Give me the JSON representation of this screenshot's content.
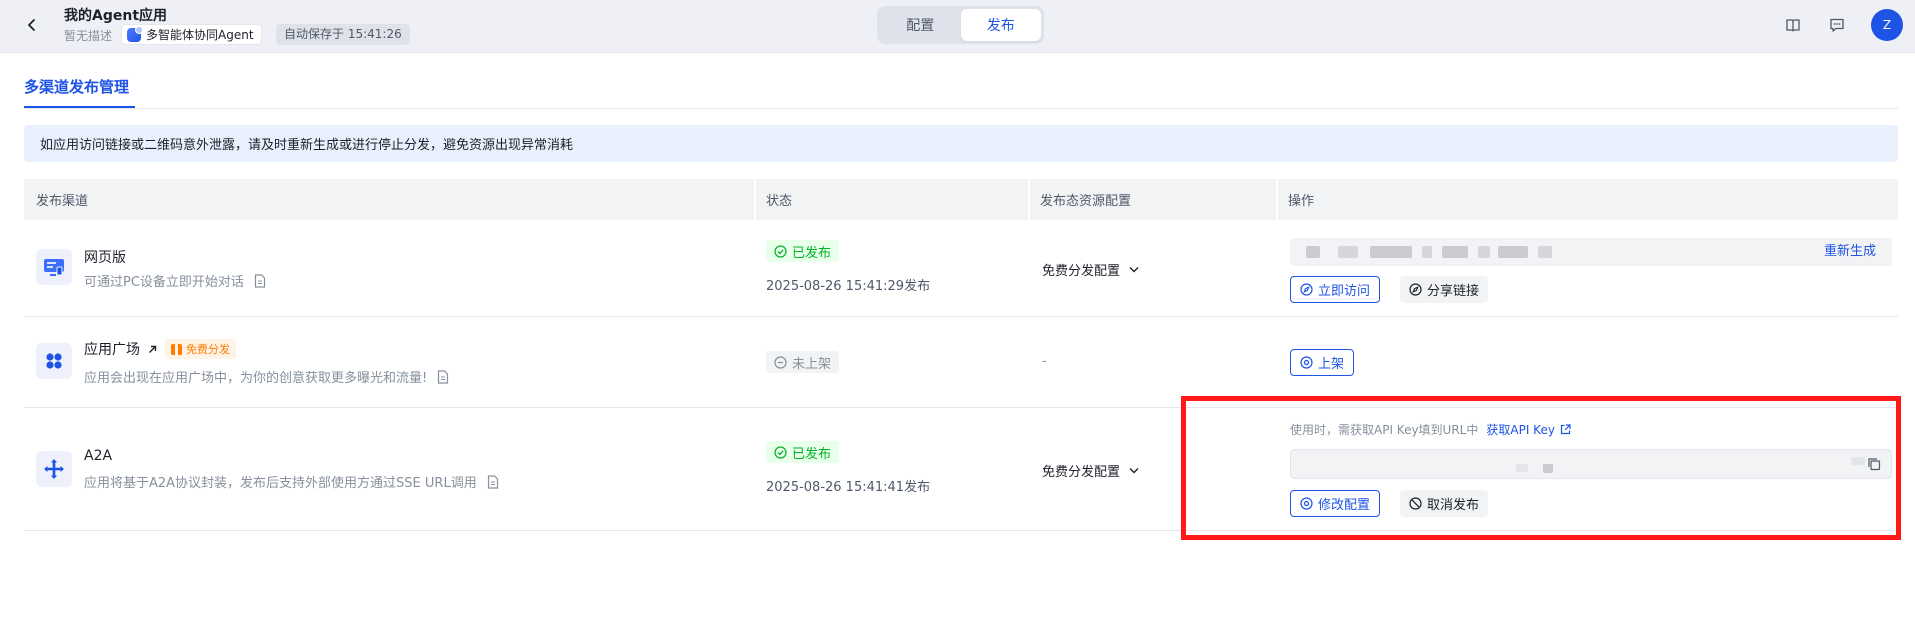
{
  "header": {
    "app_title": "我的Agent应用",
    "app_desc": "暂无描述",
    "mode_tag": "多智能体协同Agent",
    "autosave": "自动保存于 15:41:26",
    "tabs": [
      {
        "label": "配置",
        "active": false
      },
      {
        "label": "发布",
        "active": true
      }
    ],
    "avatar_initial": "Z",
    "icons": [
      "chevron-left-icon",
      "book-icon",
      "feedback-icon"
    ]
  },
  "section": {
    "title": "多渠道发布管理",
    "notice": "如应用访问链接或二维码意外泄露，请及时重新生成或进行停止分发，避免资源出现异常消耗"
  },
  "table": {
    "columns": [
      "发布渠道",
      "状态",
      "发布态资源配置",
      "操作"
    ],
    "rows": [
      {
        "name": "网页版",
        "desc": "可通过PC设备立即开始对话",
        "status": "已发布",
        "status_kind": "published",
        "time": "2025-08-26 15:41:29发布",
        "resource": "免费分发配置",
        "action_link": "重新生成",
        "buttons": [
          "立即访问",
          "分享链接"
        ]
      },
      {
        "name": "应用广场",
        "badge": "免费分发",
        "desc": "应用会出现在应用广场中，为你的创意获取更多曝光和流量!",
        "status": "未上架",
        "status_kind": "unlisted",
        "resource": "-",
        "buttons": [
          "上架"
        ]
      },
      {
        "name": "A2A",
        "desc": "应用将基于A2A协议封装，发布后支持外部使用方通过SSE URL调用",
        "status": "已发布",
        "status_kind": "published",
        "time": "2025-08-26 15:41:41发布",
        "resource": "免费分发配置",
        "api_tip": "使用时，需获取API Key填到URL中",
        "api_link": "获取API Key",
        "buttons": [
          "修改配置",
          "取消发布"
        ]
      }
    ]
  },
  "colors": {
    "primary": "#1e54e6",
    "success": "#00b42a",
    "warning": "#ff7d00",
    "highlight": "#ff1a1a"
  }
}
